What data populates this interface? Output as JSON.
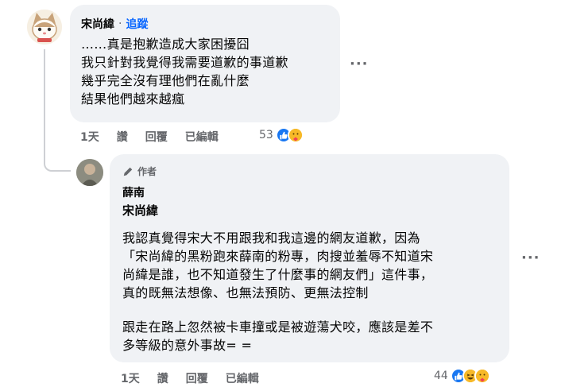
{
  "comment1": {
    "author": "宋尚緯",
    "dot": "·",
    "follow": "追蹤",
    "lines": [
      "……真是抱歉造成大家困擾囧",
      "我只針對我覺得我需要道歉的事道歉",
      "幾乎完全沒有理他們在亂什麼",
      "結果他們越來越瘋"
    ],
    "more": "···",
    "actions": {
      "time": "1天",
      "like": "讚",
      "reply": "回覆",
      "edited": "已編輯"
    },
    "reaction_count": "53"
  },
  "comment2": {
    "badge": "作者",
    "author": "薛南",
    "mention": "宋尚緯",
    "lines": [
      "我認真覺得宋大不用跟我和我這邊的網友道歉，因為",
      "「宋尚緯的黑粉跑來薛南的粉專，肉搜並羞辱不知道宋",
      "尚緯是誰，也不知道發生了什麼事的網友們」這件事，",
      "真的既無法想像、也無法預防、更無法控制"
    ],
    "lines2": [
      "跟走在路上忽然被卡車撞或是被遊蕩犬咬，應該是差不",
      "多等級的意外事故= ="
    ],
    "more": "···",
    "actions": {
      "time": "1天",
      "like": "讚",
      "reply": "回覆",
      "edited": "已編輯"
    },
    "reaction_count": "44"
  }
}
